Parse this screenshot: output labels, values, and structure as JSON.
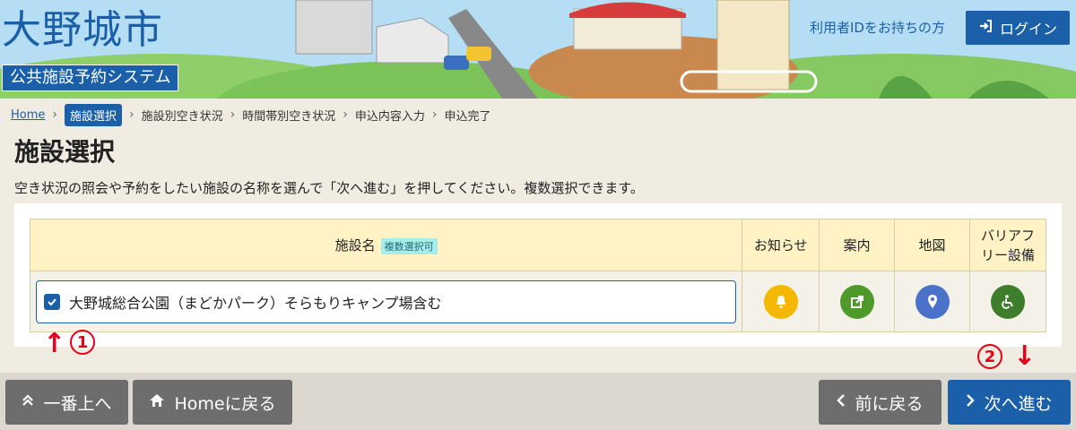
{
  "header": {
    "city_name": "大野城市",
    "system_name": "公共施設予約システム",
    "id_holder_text": "利用者IDをお持ちの方",
    "login_label": "ログイン"
  },
  "breadcrumb": {
    "home": "Home",
    "current": "施設選択",
    "steps": [
      "施設別空き状況",
      "時間帯別空き状況",
      "申込内容入力",
      "申込完了"
    ]
  },
  "page": {
    "title": "施設選択",
    "description": "空き状況の照会や予約をしたい施設の名称を選んで「次へ進む」を押してください。複数選択できます。"
  },
  "table": {
    "headers": {
      "facility_name": "施設名",
      "multi_select_badge": "複数選択可",
      "notice": "お知らせ",
      "guide": "案内",
      "map": "地図",
      "barrier_free": "バリアフリー設備"
    },
    "rows": [
      {
        "name": "大野城総合公園（まどかパーク）そらもりキャンプ場含む",
        "checked": true
      }
    ]
  },
  "annotations": {
    "step1": "1",
    "step2": "2"
  },
  "footer": {
    "top_label": "一番上へ",
    "home_label": "Homeに戻る",
    "back_label": "前に戻る",
    "next_label": "次へ進む"
  },
  "colors": {
    "brand_blue": "#1b5fa8",
    "notice_yellow": "#f5b800",
    "guide_green": "#4d9a2a",
    "map_blue": "#4a72c9",
    "barrier_green": "#3e7d2c",
    "annotation_red": "#e4001a"
  },
  "icons": {
    "login": "sign-in-icon",
    "notice": "bell-icon",
    "guide": "external-link-icon",
    "map": "map-pin-icon",
    "barrier_free": "wheelchair-icon",
    "top": "double-chevron-up-icon",
    "home": "home-icon",
    "back": "chevron-left-icon",
    "next": "chevron-right-icon"
  }
}
